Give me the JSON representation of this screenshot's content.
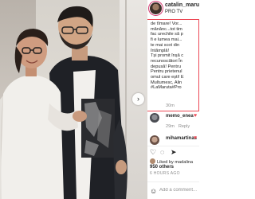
{
  "post": {
    "photo_alt": "",
    "next_label": "›"
  },
  "header": {
    "username": "catalin_maruta",
    "verified_mark": "✓",
    "subtitle": "PRO TV"
  },
  "caption": {
    "lines": [
      "de tîmare! Vor...",
      "mânânc...tot tim",
      "fac urechile să p",
      "fi e lumea mai...",
      "te mai scot din",
      "întâmplă!",
      "Tși promit înșă c",
      "recunoscători În",
      "depusă! Pentru",
      "Pentru prietenul",
      "omul care ești! E",
      "Multumesc, Alin",
      "#LaMaruta#Pro"
    ],
    "time": "30m"
  },
  "comments": [
    {
      "username": "memo_enea",
      "has_heart": true,
      "time": "29m",
      "reply": "Reply"
    },
    {
      "username": "mihamartinas",
      "has_heart": true,
      "time": "",
      "reply": ""
    }
  ],
  "actions": {
    "like_icon": "heart-outline-icon",
    "comment_icon": "comment-icon",
    "share_icon": "share-icon"
  },
  "likes": {
    "liked_by": "Liked by madalina",
    "count": "950 others",
    "date": "6 HOURS AGO"
  },
  "add_comment": {
    "placeholder": "Add a comment..."
  },
  "colors": {
    "accent_red": "#ed4956",
    "verified_blue": "#3897f0",
    "text": "#262626",
    "muted": "#8e8e8e"
  }
}
